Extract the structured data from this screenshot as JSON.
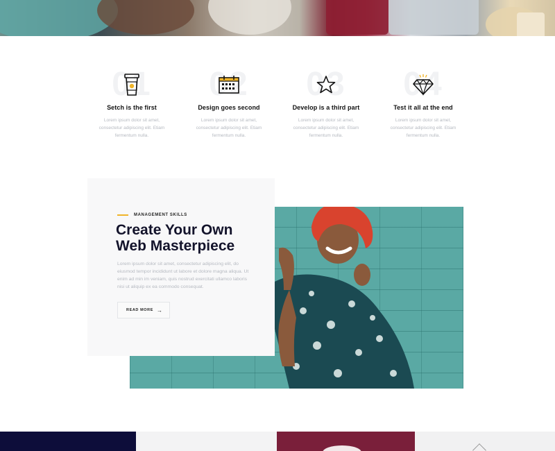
{
  "hero": {
    "image_description_name": "team-photo-banner"
  },
  "features": [
    {
      "number": "01",
      "icon": "coffee-cup-icon",
      "title": "Setch is the first",
      "desc": "Lorem ipsum dolor sit amet, consectetur adipiscing elit. Etiam fermentum nulla."
    },
    {
      "number": "02",
      "icon": "calendar-icon",
      "title": "Design goes second",
      "desc": "Lorem ipsum dolor sit amet, consectetur adipiscing elit. Etiam fermentum nulla."
    },
    {
      "number": "03",
      "icon": "star-icon",
      "title": "Develop is a third part",
      "desc": "Lorem ipsum dolor sit amet, consectetur adipiscing elit. Etiam fermentum nulla."
    },
    {
      "number": "04",
      "icon": "diamond-icon",
      "title": "Test it all at the end",
      "desc": "Lorem ipsum dolor sit amet, consectetur adipiscing elit. Etiam fermentum nulla."
    }
  ],
  "promo": {
    "eyebrow": "MANAGEMENT SKILLS",
    "headline_line1": "Create Your Own",
    "headline_line2": "Web Masterpiece",
    "body": "Lorem ipsum dolor sit amet, consectetur adipiscing elit, do eiusmod tempor incididunt ut labore et dolore magna aliqua. Ut enim ad min im veniam, quis nostrud exercitati ullamco laboris nisi ut aliquip ex ea commodo consequat.",
    "button_label": "READ MORE",
    "button_arrow": "→"
  },
  "colors": {
    "accent": "#f0b429",
    "heading": "#13132b",
    "muted_text": "#b5b9c0",
    "photo_teal": "#5aa9a4",
    "bottom_navy": "#0d0d3a",
    "bottom_grey": "#f3f3f4",
    "bottom_maroon": "#7a1f3a"
  }
}
